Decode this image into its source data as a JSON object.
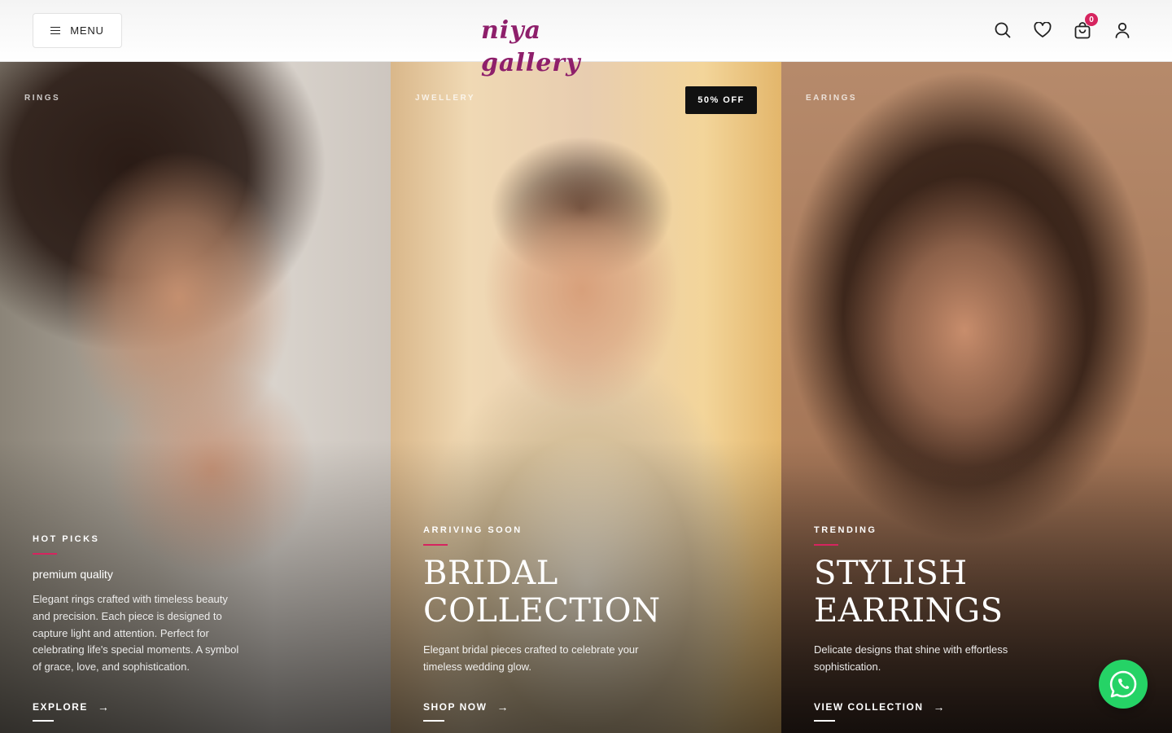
{
  "header": {
    "menu_label": "MENU",
    "logo_text": "niya gallery",
    "cart_count": "0"
  },
  "panels": [
    {
      "tag": "RINGS",
      "eyebrow": "HOT PICKS",
      "subtitle": "premium quality",
      "description": "Elegant rings crafted with timeless beauty and precision. Each piece is designed to capture light and attention. Perfect for celebrating life's special moments. A symbol of grace, love, and sophistication.",
      "cta": "EXPLORE"
    },
    {
      "tag": "JWELLERY",
      "badge": "50% OFF",
      "eyebrow": "ARRIVING SOON",
      "title_line1": "BRIDAL",
      "title_line2": "COLLECTION",
      "description": "Elegant bridal pieces crafted to celebrate your timeless wedding glow.",
      "cta": "SHOP NOW"
    },
    {
      "tag": "EARINGS",
      "eyebrow": "TRENDING",
      "title_line1": "STYLISH",
      "title_line2": "EARRINGS",
      "description": "Delicate designs that shine with effortless sophistication.",
      "cta": "VIEW COLLECTION"
    }
  ],
  "colors": {
    "accent": "#d6245f",
    "brand": "#8e1f6b",
    "whatsapp": "#25d366"
  }
}
